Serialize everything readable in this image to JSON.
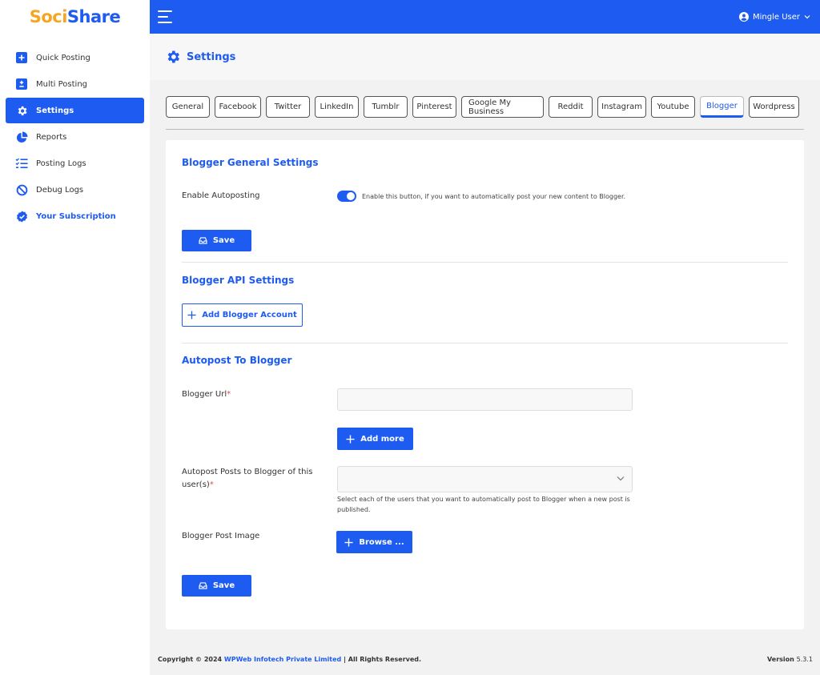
{
  "brand": {
    "logo_part1": "Soci",
    "logo_part2": "Share"
  },
  "sidebar": {
    "items": [
      {
        "label": "Quick Posting"
      },
      {
        "label": "Multi Posting"
      },
      {
        "label": "Settings"
      },
      {
        "label": "Reports"
      },
      {
        "label": "Posting Logs"
      },
      {
        "label": "Debug Logs"
      },
      {
        "label": "Your Subscription"
      }
    ]
  },
  "header": {
    "user_name": "Mingle User"
  },
  "page": {
    "title": "Settings"
  },
  "tabs": [
    {
      "label": "General"
    },
    {
      "label": "Facebook"
    },
    {
      "label": "Twitter"
    },
    {
      "label": "LinkedIn"
    },
    {
      "label": "Tumblr"
    },
    {
      "label": "Pinterest"
    },
    {
      "label": "Google My Business"
    },
    {
      "label": "Reddit"
    },
    {
      "label": "Instagram"
    },
    {
      "label": "Youtube"
    },
    {
      "label": "Blogger"
    },
    {
      "label": "Wordpress"
    }
  ],
  "general": {
    "title": "Blogger General Settings",
    "autopost_label": "Enable Autoposting",
    "autopost_help": "Enable this button, if you want to automatically post your new content to Blogger.",
    "autopost_enabled": true,
    "save_label": "Save"
  },
  "api": {
    "title": "Blogger API Settings",
    "add_account_label": "Add Blogger Account"
  },
  "autopost": {
    "title": "Autopost To Blogger",
    "url_label": "Blogger Url",
    "required_mark": "*",
    "url_value": "",
    "add_more_label": "Add more",
    "users_label_line1": "Autopost Posts to Blogger of this",
    "users_label_line2": "user(s)",
    "users_help": "Select each of the users that you want to automatically post to Blogger when a new post is published.",
    "image_label": "Blogger Post Image",
    "browse_label": "Browse ...",
    "save_label": "Save"
  },
  "footer": {
    "copyright_prefix": "Copyright © 2024",
    "company": "WPWeb Infotech Private Limited",
    "rights": "| All Rights Reserved.",
    "version_label": "Version",
    "version_number": "5.3.1"
  },
  "colors": {
    "primary": "#1e5bf0",
    "logo_accent": "#f5a623",
    "required": "#d9534f"
  }
}
